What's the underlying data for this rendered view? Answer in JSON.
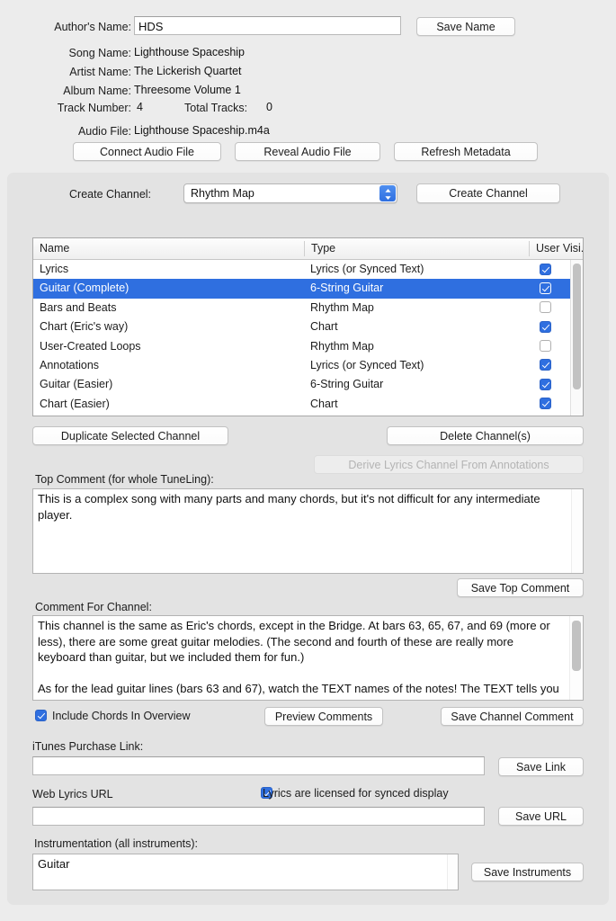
{
  "metadata": {
    "author_label": "Author's Name:",
    "author_value": "HDS",
    "save_name_button": "Save Name",
    "song_label": "Song Name:",
    "song_value": "Lighthouse Spaceship",
    "artist_label": "Artist Name:",
    "artist_value": "The Lickerish Quartet",
    "album_label": "Album Name:",
    "album_value": "Threesome Volume 1",
    "track_label": "Track Number:",
    "track_value": "4",
    "total_tracks_label": "Total Tracks:",
    "total_tracks_value": "0",
    "audio_file_label": "Audio File:",
    "audio_file_value": "Lighthouse Spaceship.m4a",
    "connect_button": "Connect Audio File",
    "reveal_button": "Reveal Audio File",
    "refresh_button": "Refresh Metadata"
  },
  "create_channel": {
    "label": "Create Channel:",
    "selected_type": "Rhythm Map",
    "button": "Create Channel"
  },
  "channel_table": {
    "columns": [
      "Name",
      "Type",
      "User Visi..."
    ],
    "rows": [
      {
        "name": "Lyrics",
        "type": "Lyrics (or Synced Text)",
        "visible": true,
        "selected": false
      },
      {
        "name": "Guitar (Complete)",
        "type": "6-String Guitar",
        "visible": true,
        "selected": true
      },
      {
        "name": "Bars and Beats",
        "type": "Rhythm Map",
        "visible": false,
        "selected": false
      },
      {
        "name": "Chart (Eric's way)",
        "type": "Chart",
        "visible": true,
        "selected": false
      },
      {
        "name": "User-Created Loops",
        "type": "Rhythm Map",
        "visible": false,
        "selected": false
      },
      {
        "name": "Annotations",
        "type": "Lyrics (or Synced Text)",
        "visible": true,
        "selected": false
      },
      {
        "name": "Guitar (Easier)",
        "type": "6-String Guitar",
        "visible": true,
        "selected": false
      },
      {
        "name": "Chart (Easier)",
        "type": "Chart",
        "visible": true,
        "selected": false
      }
    ]
  },
  "channel_actions": {
    "duplicate_button": "Duplicate Selected Channel",
    "delete_button": "Delete Channel(s)",
    "derive_button": "Derive Lyrics Channel From Annotations"
  },
  "top_comment": {
    "label": "Top Comment (for whole TuneLing):",
    "text": "This is a complex song with many parts and many chords, but it's not difficult for any intermediate player.",
    "save_button": "Save Top Comment"
  },
  "channel_comment": {
    "label": "Comment For Channel:",
    "paragraph1": "This channel is the same as Eric's chords, except in the Bridge. At bars 63, 65, 67, and 69 (more or less), there are some great guitar melodies. (The second and fourth of these are really more keyboard than guitar, but we included them for fun.)",
    "paragraph2": "As for the lead guitar lines (bars 63 and 67), watch the TEXT names of the notes! The TEXT tells you how to bend the notes, as Eric does, using the fret positions as shown. This goes by",
    "include_chords_label": "Include Chords In Overview",
    "include_chords_checked": true,
    "preview_button": "Preview Comments",
    "save_button": "Save Channel Comment"
  },
  "links": {
    "itunes_label": "iTunes Purchase Link:",
    "itunes_value": "",
    "itunes_save_button": "Save Link",
    "weblyrics_label": "Web Lyrics URL",
    "weblyrics_value": "",
    "weblyrics_save_button": "Save URL",
    "licensed_label": "Lyrics are licensed for synced display",
    "licensed_checked": true
  },
  "instrumentation": {
    "label": "Instrumentation (all instruments):",
    "value": "Guitar",
    "save_button": "Save Instruments"
  },
  "colors": {
    "accent": "#2f6fe0",
    "window_bg": "#ececec",
    "panel_bg": "#e3e3e3"
  }
}
